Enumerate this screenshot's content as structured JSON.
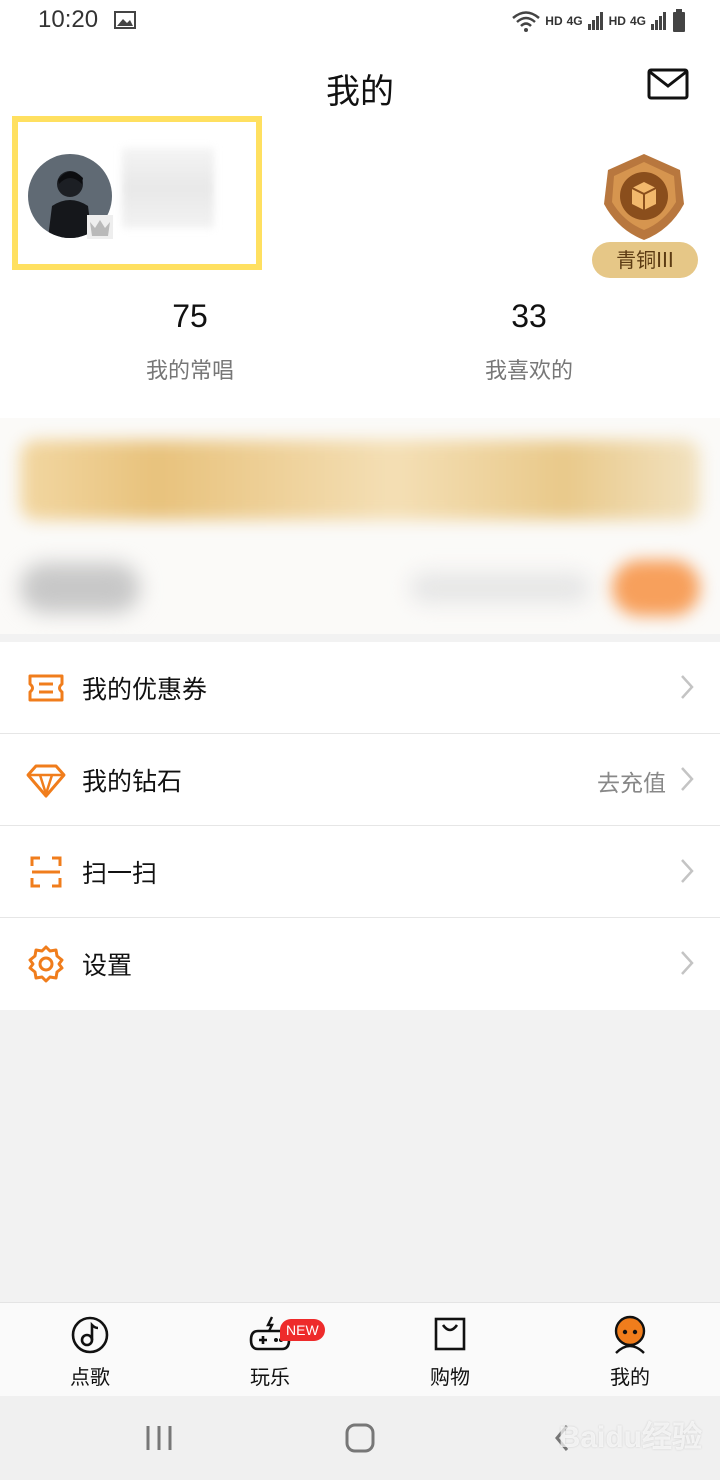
{
  "status_bar": {
    "time": "10:20",
    "network_labels": [
      "HD",
      "4G",
      "HD",
      "4G"
    ],
    "icons": [
      "image-icon",
      "wifi-icon",
      "signal-icon",
      "battery-icon"
    ]
  },
  "header": {
    "title": "我的",
    "mail_icon": "mail-icon"
  },
  "profile": {
    "avatar_icon": "avatar",
    "rank_label": "青铜III",
    "rank_icon": "bronze-rank-emblem-icon",
    "stats": [
      {
        "value": "75",
        "label": "我的常唱"
      },
      {
        "value": "33",
        "label": "我喜欢的"
      }
    ]
  },
  "menu": {
    "items": [
      {
        "label": "我的优惠券",
        "aux": "",
        "icon": "coupon-icon"
      },
      {
        "label": "我的钻石",
        "aux": "去充值",
        "icon": "diamond-icon"
      },
      {
        "label": "扫一扫",
        "aux": "",
        "icon": "scan-icon"
      },
      {
        "label": "设置",
        "aux": "",
        "icon": "gear-icon"
      }
    ]
  },
  "tab_bar": {
    "tabs": [
      {
        "label": "点歌",
        "icon": "music-note-icon"
      },
      {
        "label": "玩乐",
        "icon": "gamepad-icon",
        "badge": "NEW"
      },
      {
        "label": "购物",
        "icon": "shopping-bag-icon"
      },
      {
        "label": "我的",
        "icon": "profile-face-icon"
      }
    ]
  },
  "colors": {
    "accent_orange": "#f07d1c",
    "rank_badge_bg": "#e6c787",
    "new_badge_red": "#ee2b2b",
    "highlight_yellow": "#ffe060"
  },
  "watermark": "Baidu经验"
}
